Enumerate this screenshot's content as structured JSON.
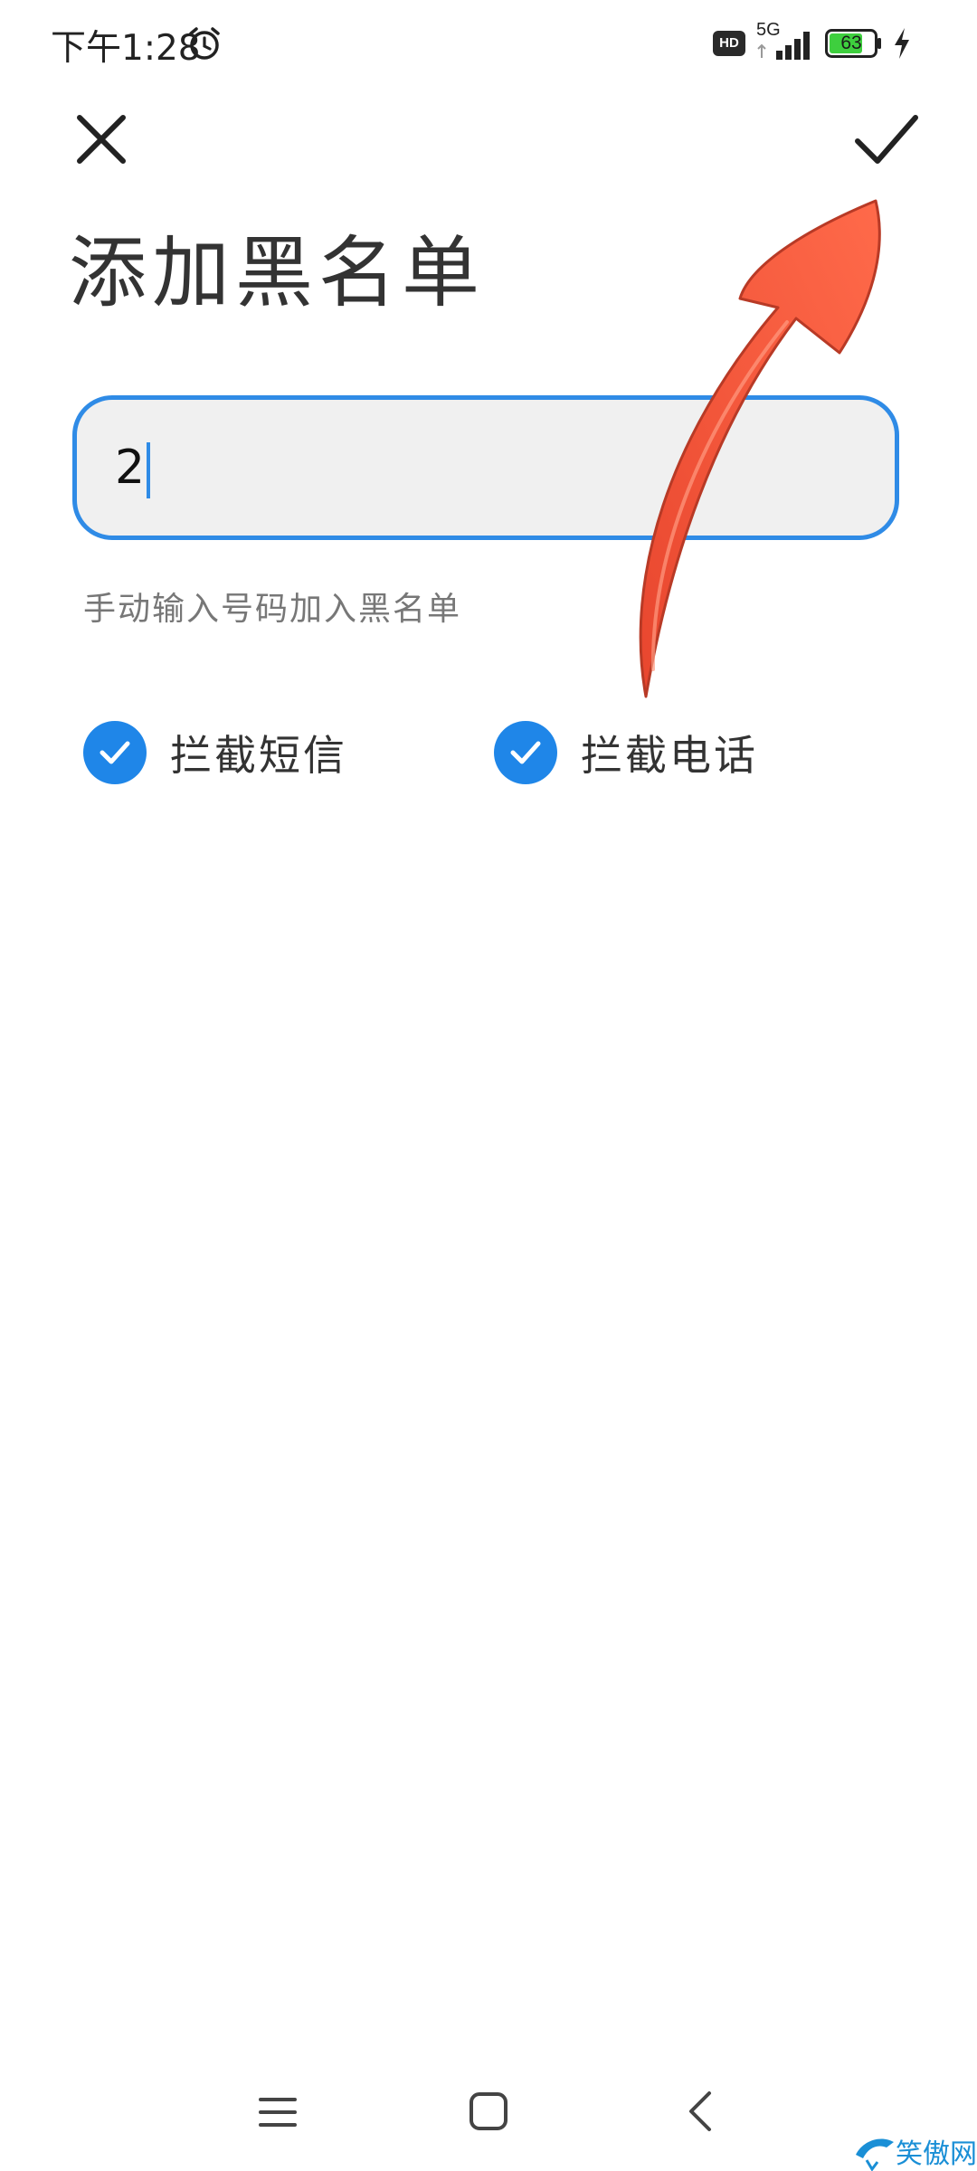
{
  "status_bar": {
    "time": "下午1:28",
    "hd_label": "HD",
    "network_label": "5G",
    "battery_level": "63",
    "icons": [
      "alarm-icon",
      "signal-icon",
      "battery-icon",
      "charging-bolt-icon"
    ]
  },
  "toolbar": {
    "close_icon": "close-icon",
    "confirm_icon": "check-icon"
  },
  "page": {
    "title": "添加黑名单"
  },
  "number_field": {
    "value": "2"
  },
  "hint": "手动输入号码加入黑名单",
  "options": [
    {
      "label": "拦截短信",
      "checked": true
    },
    {
      "label": "拦截电话",
      "checked": true
    }
  ],
  "nav_bar": {
    "icons": [
      "menu-icon",
      "home-icon",
      "back-icon"
    ]
  },
  "annotation": {
    "arrow_color": "#f2583e",
    "arrow_target": "confirm-button"
  },
  "watermark": {
    "text": "笑傲网"
  },
  "colors": {
    "accent": "#1f86e8",
    "field_border": "#2f8be6",
    "field_bg": "#f0f0f0",
    "battery_green": "#3ecf3e"
  }
}
